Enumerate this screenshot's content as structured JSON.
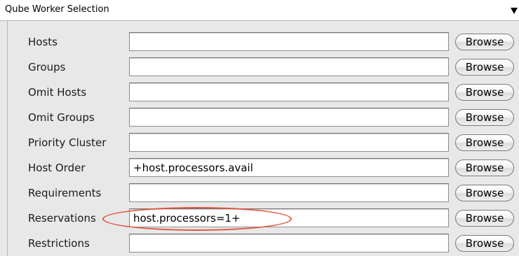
{
  "header": {
    "title": "Qube Worker Selection",
    "collapse_icon": "triangle-down-icon"
  },
  "rows": [
    {
      "label": "Hosts",
      "value": "",
      "button": "Browse"
    },
    {
      "label": "Groups",
      "value": "",
      "button": "Browse"
    },
    {
      "label": "Omit Hosts",
      "value": "",
      "button": "Browse"
    },
    {
      "label": "Omit Groups",
      "value": "",
      "button": "Browse"
    },
    {
      "label": "Priority Cluster",
      "value": "",
      "button": "Browse"
    },
    {
      "label": "Host Order",
      "value": "+host.processors.avail",
      "button": "Browse"
    },
    {
      "label": "Requirements",
      "value": "",
      "button": "Browse"
    },
    {
      "label": "Reservations",
      "value": "host.processors=1+",
      "button": "Browse"
    },
    {
      "label": "Restrictions",
      "value": "",
      "button": "Browse"
    }
  ],
  "annotation": {
    "color": "#e0553f",
    "highlights_row": "Reservations"
  }
}
